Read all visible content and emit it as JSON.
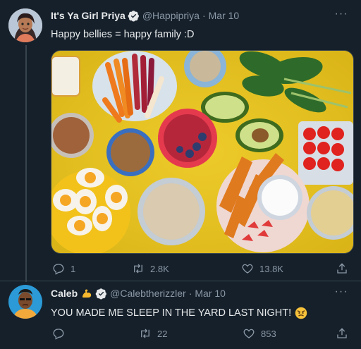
{
  "tweets": [
    {
      "author": "It's Ya Girl Priya",
      "handle": "@Happipriya",
      "separator": "·",
      "date": "Mar 10",
      "text": "Happy bellies = happy family :D",
      "media_description": "photo",
      "reply_count": "1",
      "retweet_count": "2.8K",
      "like_count": "13.8K"
    },
    {
      "author": "Caleb",
      "handle": "@Calebtherizzler",
      "separator": "·",
      "date": "Mar 10",
      "text": "YOU MADE ME SLEEP IN THE YARD LAST NIGHT!",
      "reply_count": "",
      "retweet_count": "22",
      "like_count": "853"
    }
  ],
  "more_label": "···",
  "colors": {
    "background": "#15202b",
    "text": "#e7e9ea",
    "secondary": "#8b98a5",
    "verified": "#1d9bf0",
    "border": "#38444d"
  }
}
